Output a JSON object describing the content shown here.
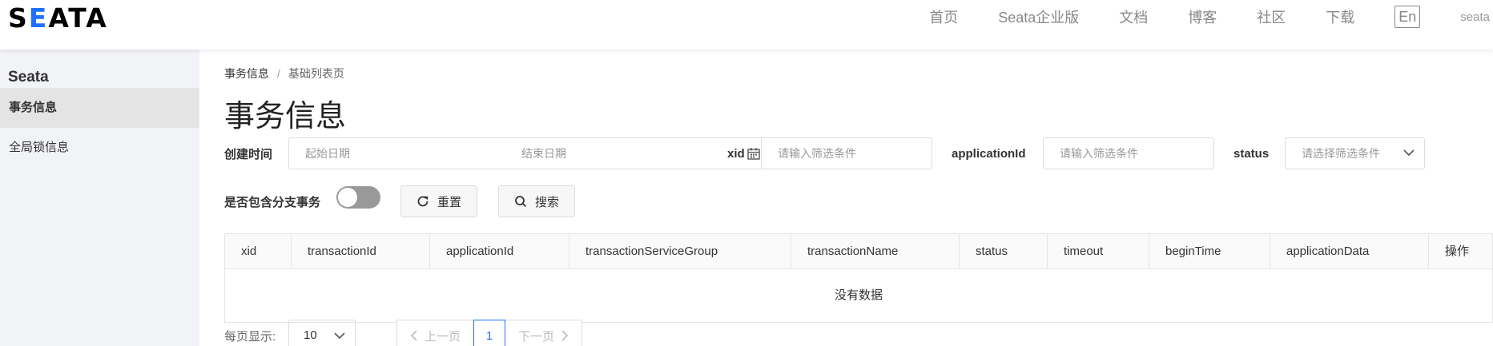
{
  "header": {
    "logo": "SEATA",
    "nav": [
      "首页",
      "Seata企业版",
      "文档",
      "博客",
      "社区",
      "下载"
    ],
    "lang": "En",
    "user": "seata"
  },
  "sidebar": {
    "title": "Seata",
    "items": [
      {
        "label": "事务信息",
        "active": true
      },
      {
        "label": "全局锁信息",
        "active": false
      }
    ]
  },
  "breadcrumb": [
    "事务信息",
    "/",
    "基础列表页"
  ],
  "page_title": "事务信息",
  "filters": {
    "created_label": "创建时间",
    "start_placeholder": "起始日期",
    "range_sep": "-",
    "end_placeholder": "结束日期",
    "xid_label": "xid",
    "xid_placeholder": "请输入筛选条件",
    "app_label": "applicationId",
    "app_placeholder": "请输入筛选条件",
    "status_label": "status",
    "status_placeholder": "请选择筛选条件",
    "branch_label": "是否包含分支事务",
    "branch_toggle_on": false,
    "reset_label": "重置",
    "search_label": "搜索"
  },
  "table": {
    "columns": [
      "xid",
      "transactionId",
      "applicationId",
      "transactionServiceGroup",
      "transactionName",
      "status",
      "timeout",
      "beginTime",
      "applicationData",
      "操作"
    ],
    "empty_text": "没有数据"
  },
  "pagination": {
    "page_size_label": "每页显示:",
    "page_size": "10",
    "prev": "上一页",
    "current": "1",
    "next": "下一页"
  },
  "colors": {
    "accent": "#1f70ff",
    "sidebar_bg": "#f2f3f7"
  }
}
